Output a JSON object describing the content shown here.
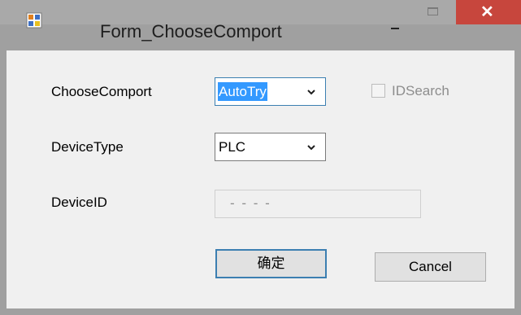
{
  "window": {
    "title": "Form_ChooseComport",
    "controls": {
      "minimize_icon": "minimize-icon",
      "maximize_icon": "maximize-icon",
      "close_icon": "close-icon",
      "close_glyph": "✕"
    },
    "title_bar_color": "#a9a9a9",
    "close_button_color": "#c7463d"
  },
  "form": {
    "choose_comport": {
      "label": "ChooseComport",
      "selected": "AutoTry"
    },
    "id_search": {
      "label": "IDSearch",
      "checked": false,
      "enabled": false
    },
    "device_type": {
      "label": "DeviceType",
      "selected": "PLC"
    },
    "device_id": {
      "label": "DeviceID",
      "value": "- - - -",
      "enabled": false
    },
    "buttons": {
      "ok_label": "确定",
      "cancel_label": "Cancel"
    }
  }
}
